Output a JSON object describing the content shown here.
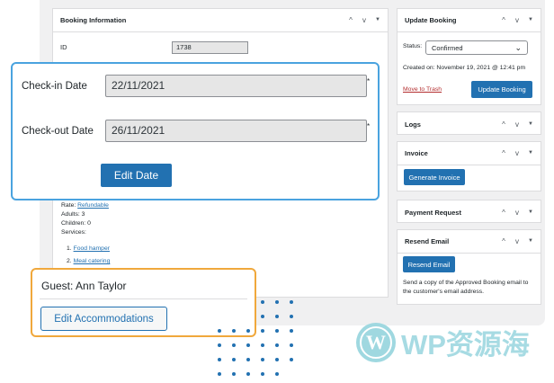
{
  "booking_info": {
    "title": "Booking Information",
    "id_label": "ID",
    "id_value": "1738",
    "rate_label": "Rate:",
    "rate_value": "Refundable",
    "adults": "Adults: 3",
    "children": "Children: 0",
    "services_label": "Services:",
    "services": [
      {
        "num": "1.",
        "name": "Food hamper"
      },
      {
        "num": "2.",
        "name": "Meal catering"
      }
    ]
  },
  "update_booking": {
    "title": "Update Booking",
    "status_label": "Status:",
    "status_value": "Confirmed",
    "created_on": "Created on: November 19, 2021 @ 12:41 pm",
    "trash_link": "Move to Trash",
    "update_button": "Update Booking"
  },
  "logs": {
    "title": "Logs"
  },
  "invoice": {
    "title": "Invoice",
    "button": "Generate Invoice"
  },
  "payment_request": {
    "title": "Payment Request"
  },
  "resend_email": {
    "title": "Resend Email",
    "button": "Resend Email",
    "description": "Send a copy of the Approved Booking email to the customer's email address."
  },
  "dates_callout": {
    "checkin_label": "Check-in Date",
    "checkin_value": "22/11/2021",
    "checkout_label": "Check-out Date",
    "checkout_value": "26/11/2021",
    "required_mark": "*",
    "edit_button": "Edit Date"
  },
  "guest_callout": {
    "guest": "Guest: Ann Taylor",
    "edit_button": "Edit Accommodations"
  },
  "icons": {
    "arrow_up": "^",
    "arrow_down": "v",
    "toggle": "▼",
    "select_chevron": "⌄"
  },
  "watermark": {
    "text": "WP资源海",
    "logo_letter": "W"
  },
  "colors": {
    "primary": "#2271b1",
    "callout_blue": "#4aa3df",
    "callout_orange": "#f0a83c",
    "trash_red": "#b32d2e"
  }
}
